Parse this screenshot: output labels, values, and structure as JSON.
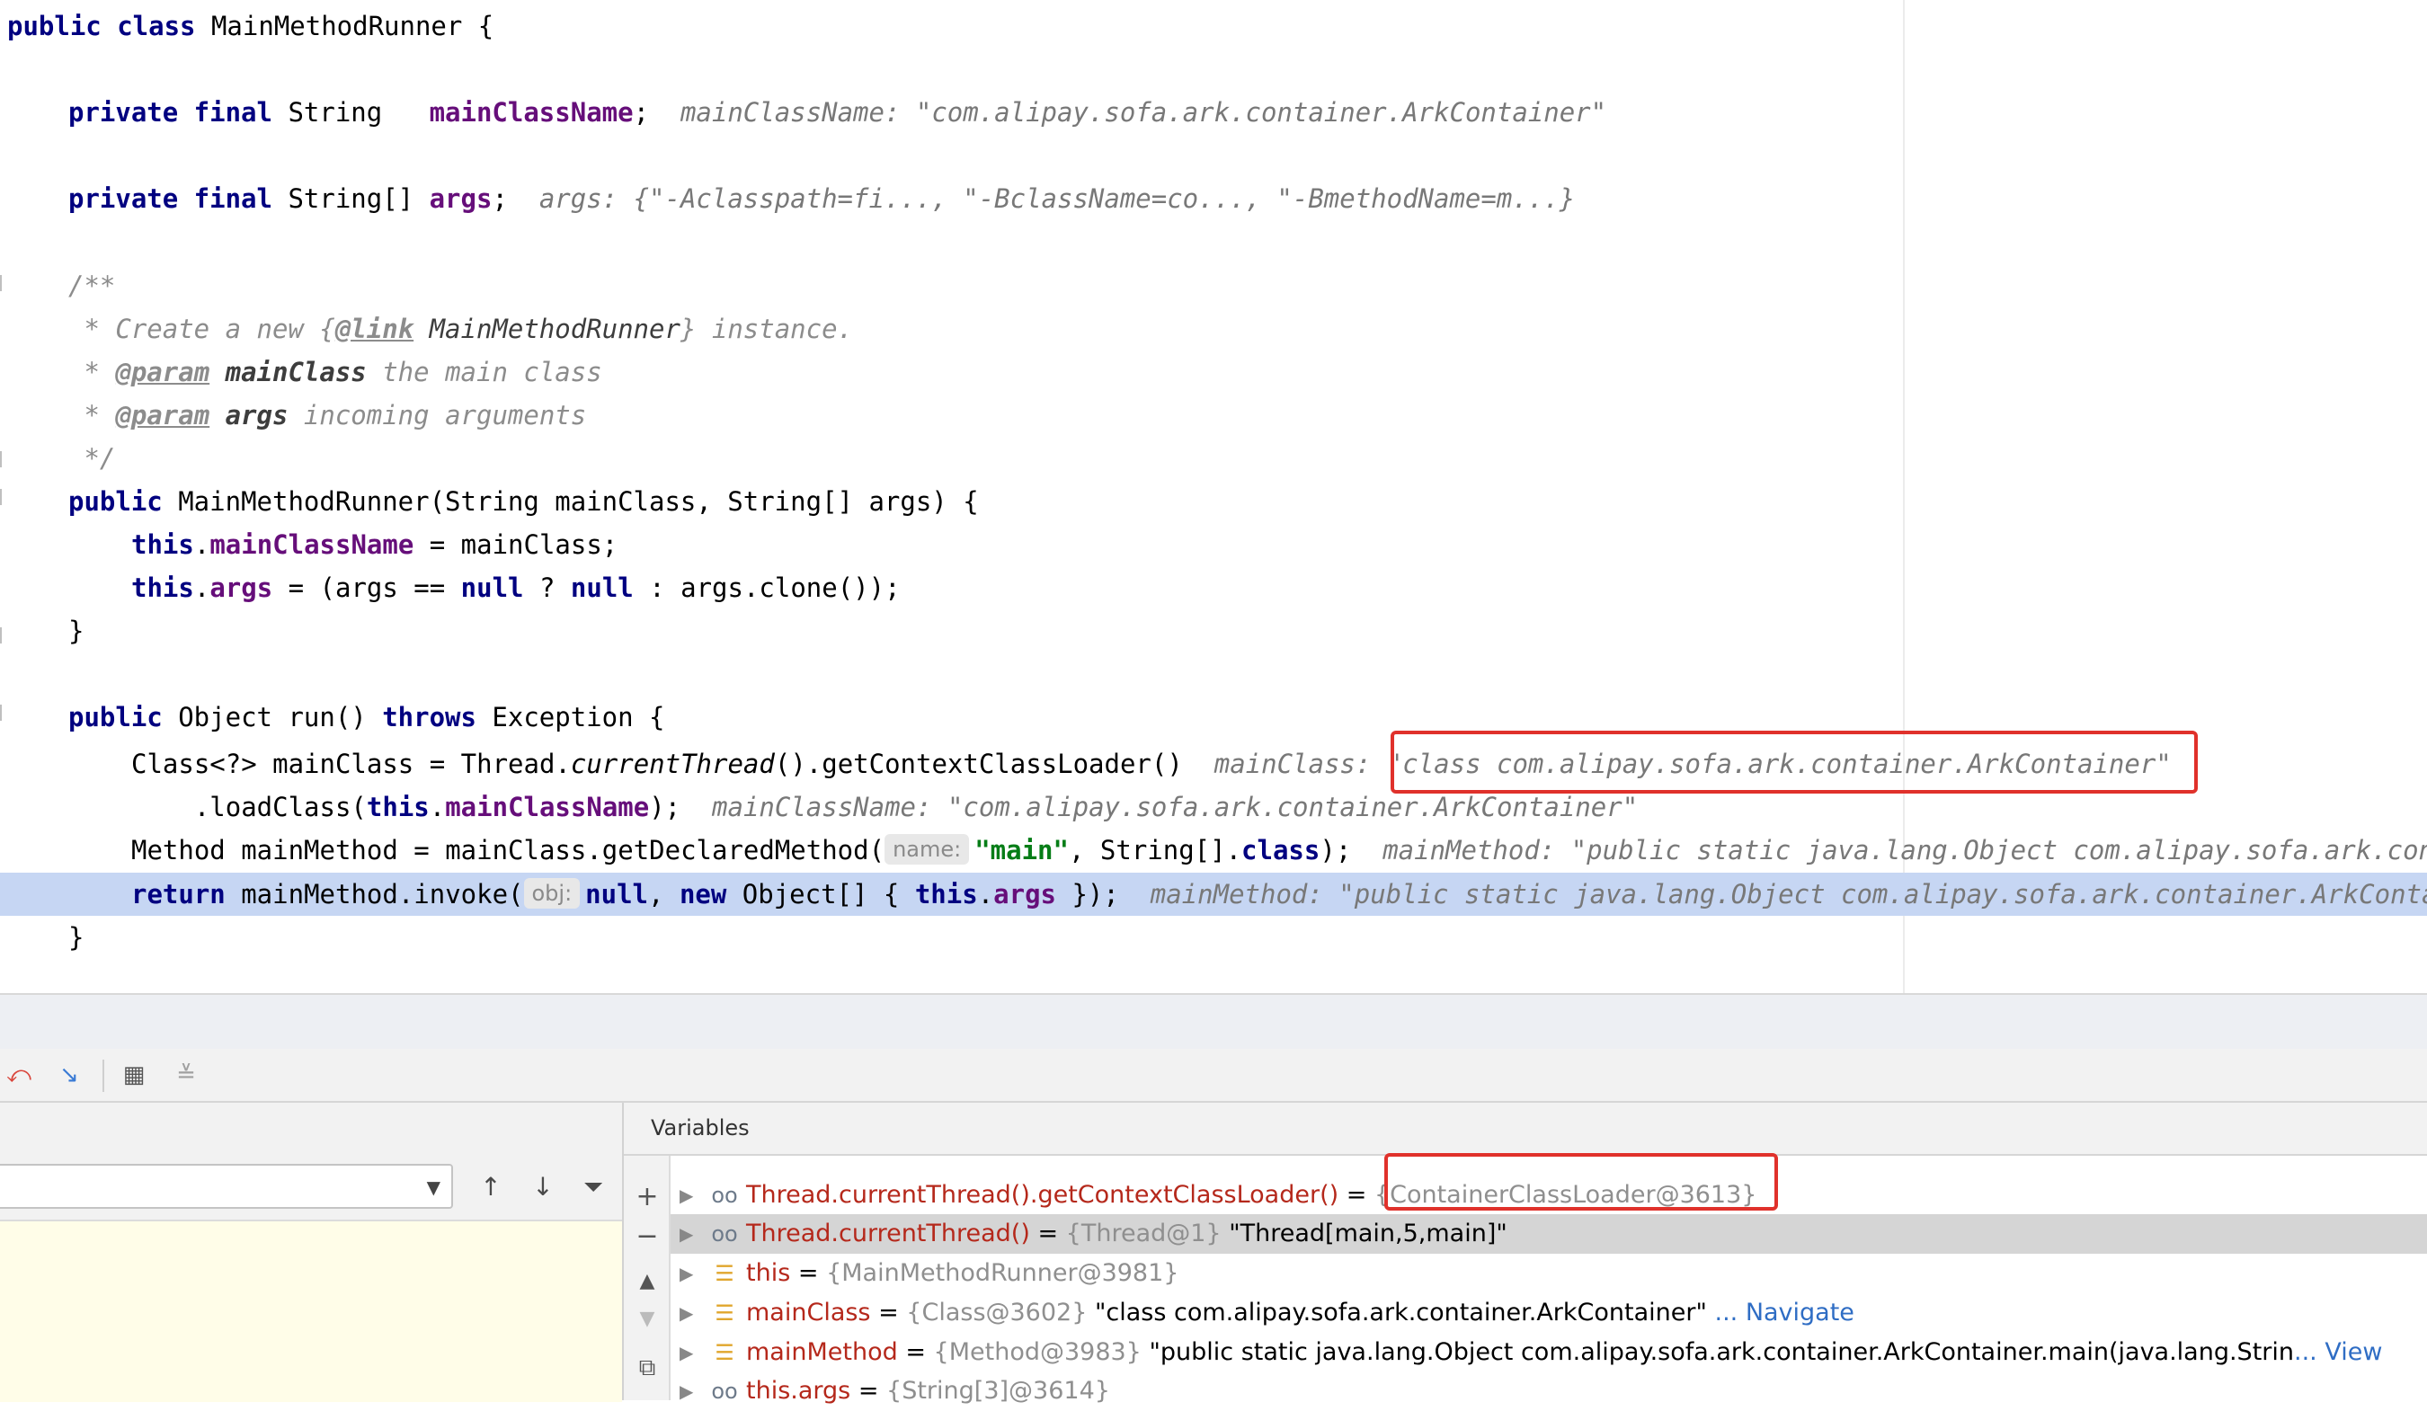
{
  "code": {
    "l0": {
      "kw1": "public class",
      "rest": " MainMethodRunner {"
    },
    "l1": {
      "kw": "private final",
      "type": " String   ",
      "field": "mainClassName",
      "semi": ";",
      "hint": "mainClassName: \"com.alipay.sofa.ark.container.ArkContainer\""
    },
    "l2": {
      "kw": "private final",
      "type": " String[] ",
      "field": "args",
      "semi": ";",
      "hint": "args: {\"-Aclasspath=fi..., \"-BclassName=co..., \"-BmethodName=m...}"
    },
    "l3": {
      "text": "/**"
    },
    "l4": {
      "pre": " * Create a new {",
      "tag": "@link",
      "name": " MainMethodRunner",
      "post": "} instance."
    },
    "l5": {
      "pre": " * ",
      "tag": "@param",
      "name": " mainClass",
      "post": " the main class"
    },
    "l6": {
      "pre": " * ",
      "tag": "@param",
      "name": " args",
      "post": " incoming arguments"
    },
    "l7": {
      "text": " */"
    },
    "l8": {
      "kw": "public",
      "rest": " MainMethodRunner(String mainClass, String[] args) {"
    },
    "l9": {
      "kw": "this",
      "dot": ".",
      "field": "mainClassName",
      "rest": " = mainClass;"
    },
    "l10": {
      "kw": "this",
      "dot": ".",
      "field": "args",
      "rest1": " = (args == ",
      "null1": "null",
      "rest2": " ? ",
      "null2": "null",
      "rest3": " : args.clone());"
    },
    "l11": {
      "text": "}"
    },
    "l12": {
      "kw": "public",
      "rest1": " Object run() ",
      "kw2": "throws",
      "rest2": " Exception {"
    },
    "l13": {
      "pre": "Class<?> mainClass = Thread.",
      "it": "currentThread",
      "post": "().getContextClassLoader()  ",
      "hint_label": "mainClass: ",
      "hint_value": "\"class com.alipay.sofa.ark.container.ArkContainer\""
    },
    "l14": {
      "pre": "    .loadClass(",
      "kw": "this",
      "dot": ".",
      "field": "mainClassName",
      "post": ");  ",
      "hint": "mainClassName: \"com.alipay.sofa.ark.container.ArkContainer\""
    },
    "l15": {
      "pre": "Method mainMethod = mainClass.getDeclaredMethod(",
      "param": "name:",
      "str": "\"main\"",
      "mid": ", String[].",
      "kw": "class",
      "post": ");  ",
      "hint": "mainMethod: \"public static java.lang.Object com.alipay.sofa.ark.container.ArkContainer.main(java.lang.String[])\""
    },
    "l16": {
      "kw1": "return",
      "pre": " mainMethod.invoke(",
      "param": "obj:",
      "null": "null",
      "mid": ", ",
      "kw2": "new",
      "mid2": " Object[] { ",
      "kw3": "this",
      "dot": ".",
      "field": "args",
      "post": " });  ",
      "hint": "mainMethod: \"public static java.lang.Object com.alipay.sofa.ark.container.ArkContainer.main(java.lang.String[])\""
    },
    "l17": {
      "text": "}"
    }
  },
  "debug": {
    "variables_title": "Variables",
    "rows": [
      {
        "name": "Thread.currentThread().getContextClassLoader()",
        "eq": " = ",
        "ref": "{ContainerClassLoader@3613}",
        "value": "",
        "link": ""
      },
      {
        "name": "Thread.currentThread()",
        "eq": " = ",
        "ref": "{Thread@1}",
        "value": " \"Thread[main,5,main]\"",
        "link": ""
      },
      {
        "name": "this",
        "eq": " = ",
        "ref": "{MainMethodRunner@3981}",
        "value": "",
        "link": ""
      },
      {
        "name": "mainClass",
        "eq": " = ",
        "ref": "{Class@3602}",
        "value": " \"class com.alipay.sofa.ark.container.ArkContainer\"",
        "link": " ... Navigate"
      },
      {
        "name": "mainMethod",
        "eq": " = ",
        "ref": "{Method@3983}",
        "value": " \"public static java.lang.Object com.alipay.sofa.ark.container.ArkContainer.main(java.lang.Strin",
        "link": "... View"
      },
      {
        "name": "this.args",
        "eq": " = ",
        "ref": "{String[3]@3614}",
        "value": "",
        "link": ""
      }
    ]
  },
  "icons": {
    "toolbar": [
      "drop-frame-icon",
      "step-out-icon",
      "table-view-icon",
      "restore-layout-icon"
    ],
    "frames": [
      "up-arrow-icon",
      "down-arrow-icon",
      "filter-icon"
    ],
    "variables": [
      "add-watch-icon",
      "remove-watch-icon",
      "move-up-icon",
      "move-down-icon",
      "copy-icon"
    ]
  },
  "colors": {
    "keyword": "#000080",
    "field": "#660e7a",
    "string": "#067d17",
    "highlight": "#c6d6f3",
    "annotation_box": "#e0312b",
    "var_name": "#b5281b",
    "link": "#2f6dc4"
  }
}
